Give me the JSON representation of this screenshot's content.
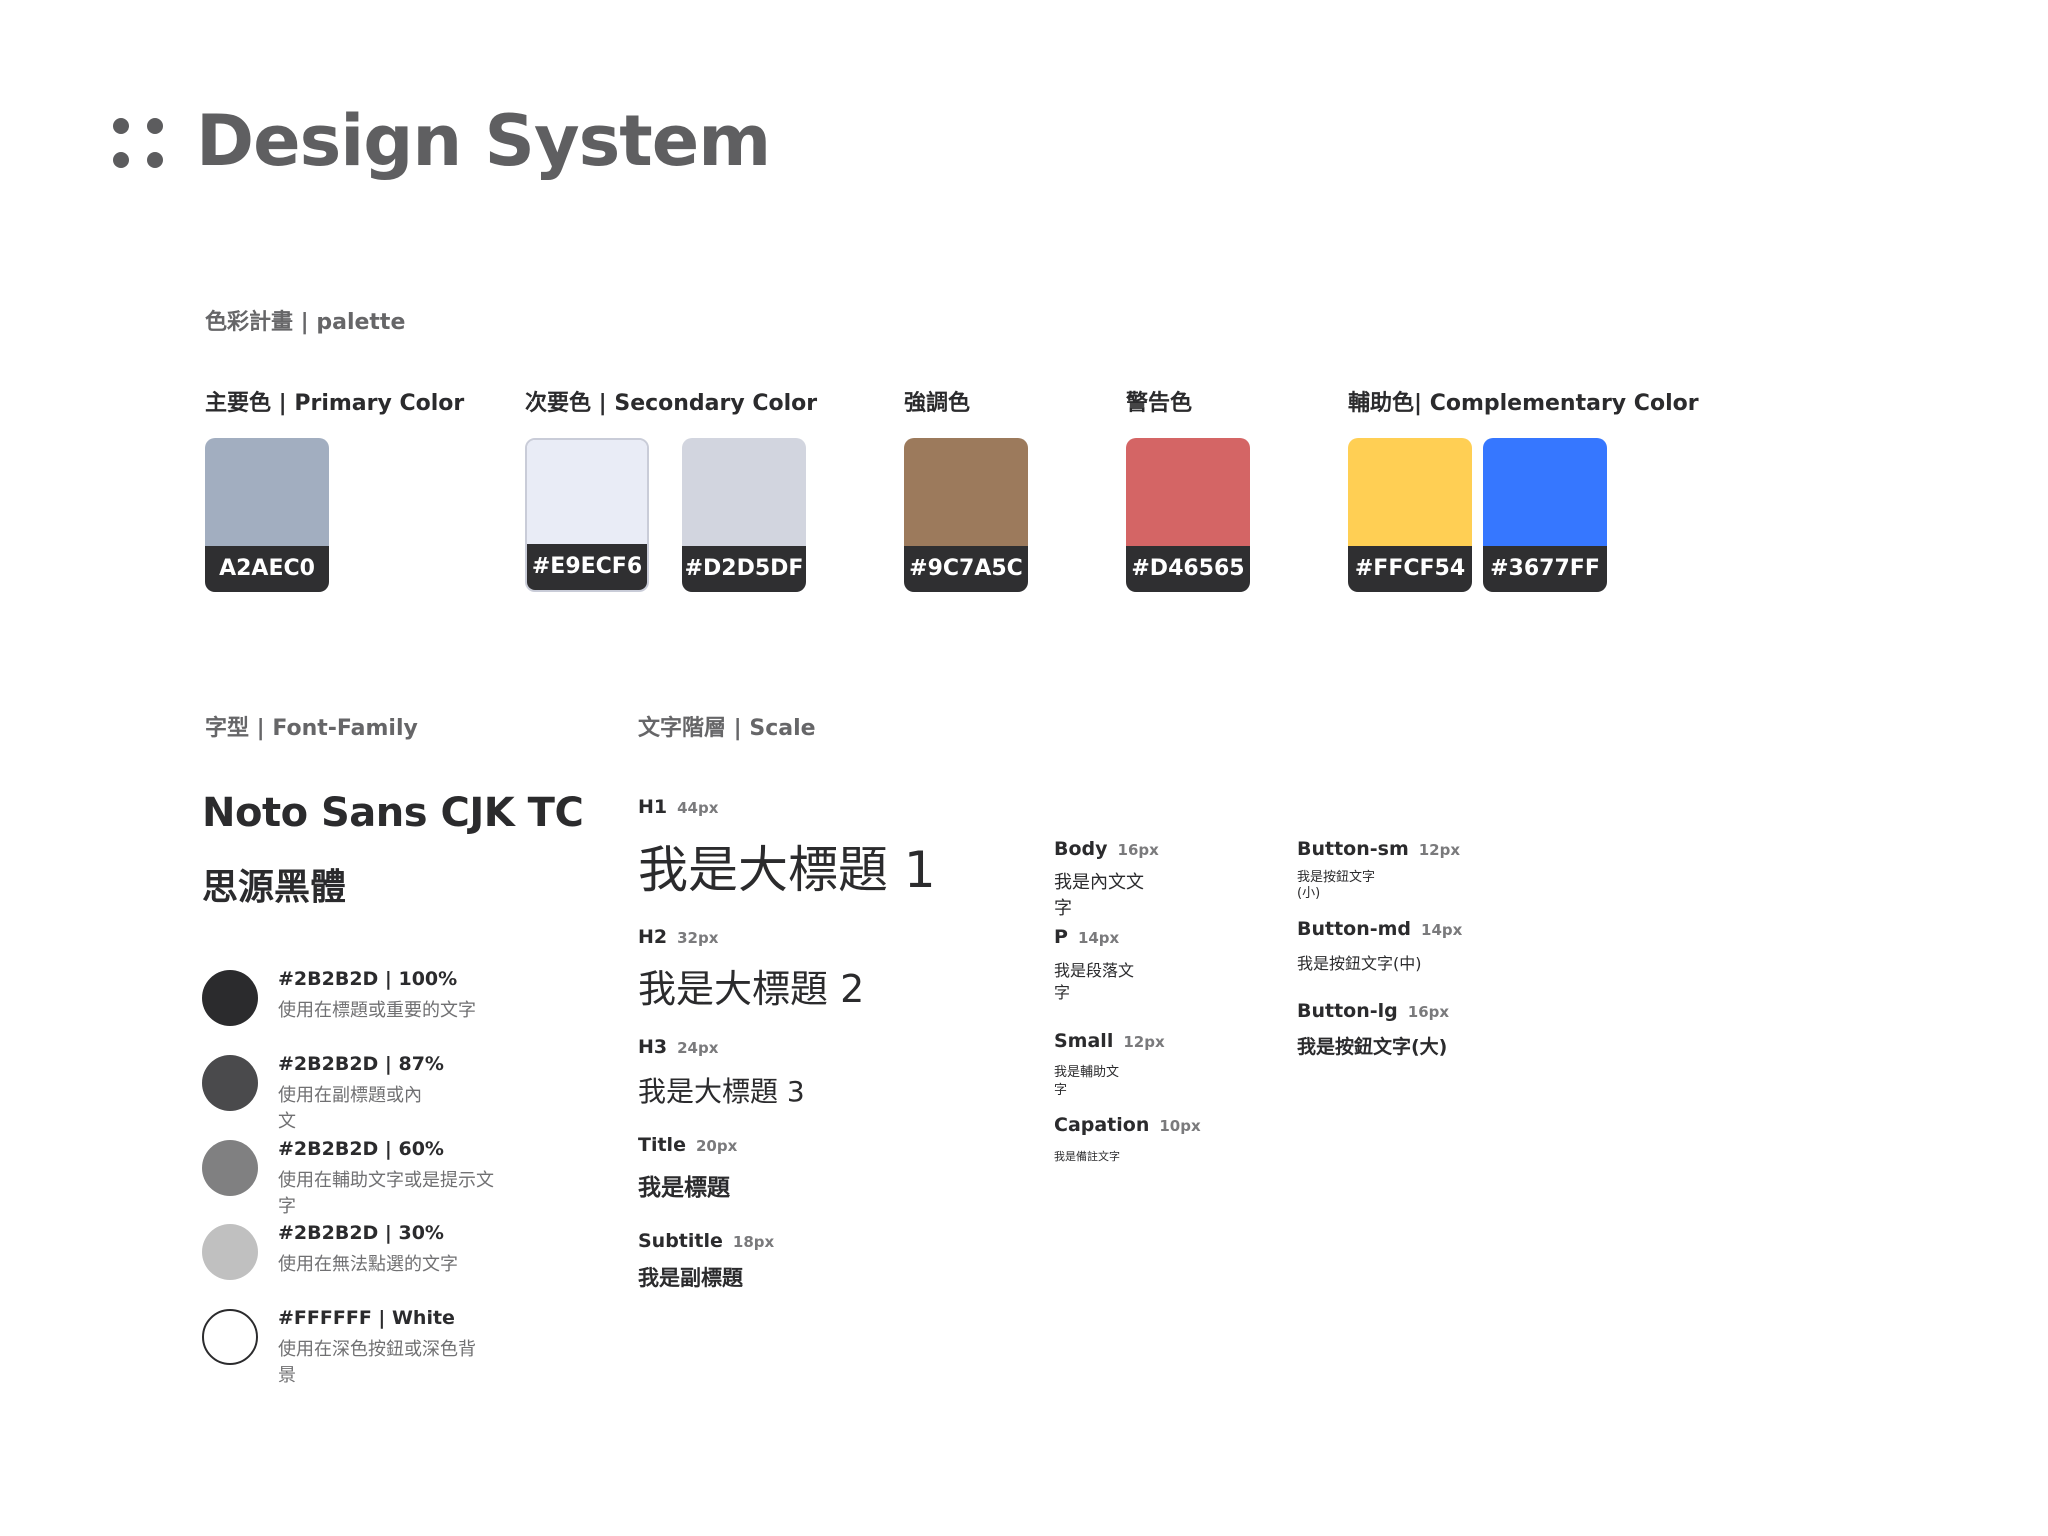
{
  "header": {
    "title": "Design System"
  },
  "palette": {
    "section_label": "色彩計畫 | palette",
    "groups": [
      {
        "title": "主要色 | Primary Color",
        "swatches": [
          {
            "code": "A2AEC0",
            "color": "#A2AEC0"
          }
        ]
      },
      {
        "title": "次要色 | Secondary Color",
        "swatches": [
          {
            "code": "#E9ECF6",
            "color": "#E9ECF6"
          },
          {
            "code": "#D2D5DF",
            "color": "#D2D5DF"
          }
        ]
      },
      {
        "title": "強調色",
        "swatches": [
          {
            "code": "#9C7A5C",
            "color": "#9C7A5C"
          }
        ]
      },
      {
        "title": "警告色",
        "swatches": [
          {
            "code": "#D46565",
            "color": "#D46565"
          }
        ]
      },
      {
        "title": "輔助色| Complementary Color",
        "swatches": [
          {
            "code": "#FFCF54",
            "color": "#FFCF54"
          },
          {
            "code": "#3677FF",
            "color": "#3677FF"
          }
        ]
      }
    ]
  },
  "font_family": {
    "section_label": "字型 | Font-Family",
    "name": "Noto Sans  CJK TC",
    "cjk_name": "思源黑體",
    "tones": [
      {
        "title": "#2B2B2D | 100%",
        "desc": "使用在標題或重要的文字",
        "color": "#2B2B2D"
      },
      {
        "title": "#2B2B2D | 87%",
        "desc": "使用在副標題或內文",
        "color": "#4a4a4c"
      },
      {
        "title": "#2B2B2D | 60%",
        "desc": "使用在輔助文字或是提示文字",
        "color": "#808081"
      },
      {
        "title": "#2B2B2D | 30%",
        "desc": "使用在無法點選的文字",
        "color": "#c0c0c0"
      },
      {
        "title": "#FFFFFF | White",
        "desc": "使用在深色按鈕或深色背景",
        "color": "#FFFFFF"
      }
    ]
  },
  "scale": {
    "section_label": "文字階層 | Scale",
    "headings": [
      {
        "label": "H1",
        "size": "44px",
        "sample": "我是大標題 1"
      },
      {
        "label": "H2",
        "size": "32px",
        "sample": "我是大標題 2"
      },
      {
        "label": "H3",
        "size": "24px",
        "sample": "我是大標題 3"
      },
      {
        "label": "Title",
        "size": "20px",
        "sample": "我是標題"
      },
      {
        "label": "Subtitle",
        "size": "18px",
        "sample": "我是副標題"
      }
    ],
    "body": [
      {
        "label": "Body",
        "size": "16px",
        "sample": "我是內文文字"
      },
      {
        "label": "P",
        "size": "14px",
        "sample": "我是段落文字"
      },
      {
        "label": "Small",
        "size": "12px",
        "sample": "我是輔助文字"
      },
      {
        "label": "Capation",
        "size": "10px",
        "sample": "我是備註文字"
      }
    ],
    "buttons": [
      {
        "label": "Button-sm",
        "size": "12px",
        "sample": "我是按鈕文字(小)"
      },
      {
        "label": "Button-md",
        "size": "14px",
        "sample": "我是按鈕文字(中)"
      },
      {
        "label": "Button-lg",
        "size": "16px",
        "sample": "我是按鈕文字(大)"
      }
    ]
  }
}
